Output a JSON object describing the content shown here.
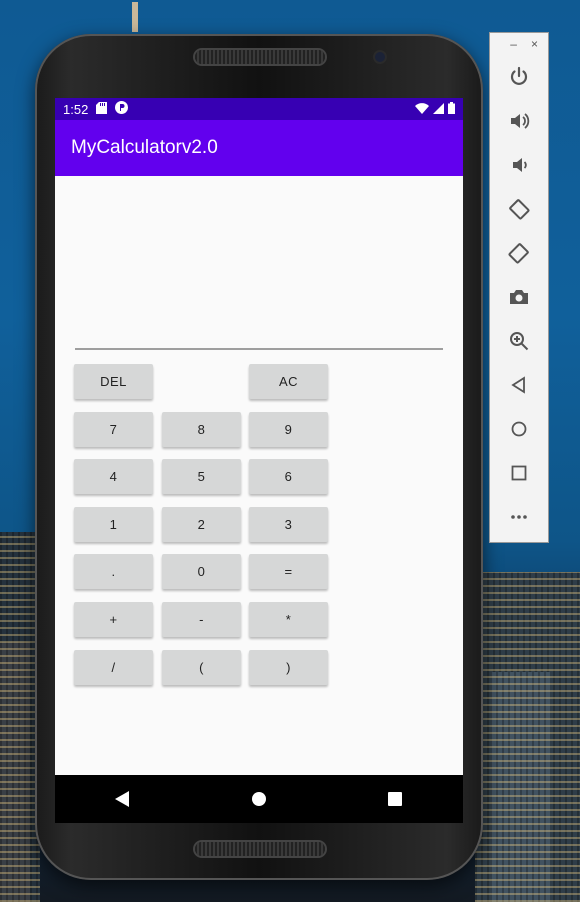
{
  "status_bar": {
    "time": "1:52"
  },
  "app_bar": {
    "title": "MyCalculatorv2.0"
  },
  "display": {
    "value": ""
  },
  "keypad": {
    "del": "DEL",
    "ac": "AC",
    "k7": "7",
    "k8": "8",
    "k9": "9",
    "k4": "4",
    "k5": "5",
    "k6": "6",
    "k1": "1",
    "k2": "2",
    "k3": "3",
    "dot": ".",
    "k0": "0",
    "equals": "=",
    "plus": "+",
    "minus": "-",
    "multiply": "*",
    "divide": "/",
    "lparen": "(",
    "rparen": ")"
  },
  "emulator_panel": {
    "minimize": "–",
    "close": "×",
    "tools": [
      "power-icon",
      "volume-up-icon",
      "volume-down-icon",
      "rotate-left-icon",
      "rotate-right-icon",
      "camera-icon",
      "zoom-icon",
      "back-icon",
      "home-icon",
      "overview-icon",
      "more-icon"
    ]
  },
  "colors": {
    "status_bar": "#3700b3",
    "app_bar": "#6200ee",
    "key_bg": "#d6d7d7"
  }
}
